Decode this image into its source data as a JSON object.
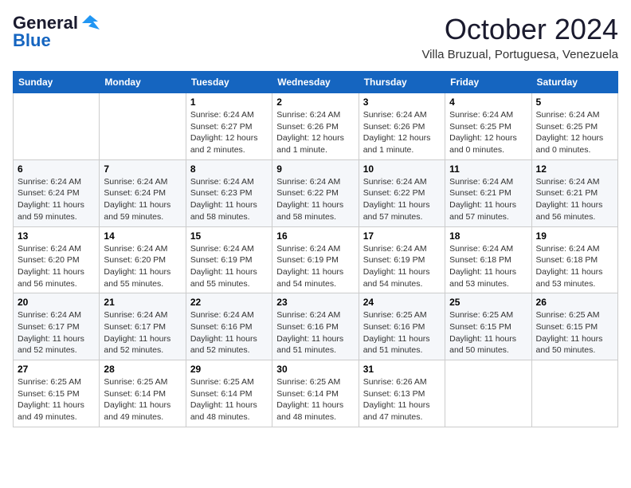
{
  "header": {
    "logo_general": "General",
    "logo_blue": "Blue",
    "month_title": "October 2024",
    "location": "Villa Bruzual, Portuguesa, Venezuela"
  },
  "calendar": {
    "days_of_week": [
      "Sunday",
      "Monday",
      "Tuesday",
      "Wednesday",
      "Thursday",
      "Friday",
      "Saturday"
    ],
    "weeks": [
      [
        {
          "day": "",
          "info": ""
        },
        {
          "day": "",
          "info": ""
        },
        {
          "day": "1",
          "info": "Sunrise: 6:24 AM\nSunset: 6:27 PM\nDaylight: 12 hours and 2 minutes."
        },
        {
          "day": "2",
          "info": "Sunrise: 6:24 AM\nSunset: 6:26 PM\nDaylight: 12 hours and 1 minute."
        },
        {
          "day": "3",
          "info": "Sunrise: 6:24 AM\nSunset: 6:26 PM\nDaylight: 12 hours and 1 minute."
        },
        {
          "day": "4",
          "info": "Sunrise: 6:24 AM\nSunset: 6:25 PM\nDaylight: 12 hours and 0 minutes."
        },
        {
          "day": "5",
          "info": "Sunrise: 6:24 AM\nSunset: 6:25 PM\nDaylight: 12 hours and 0 minutes."
        }
      ],
      [
        {
          "day": "6",
          "info": "Sunrise: 6:24 AM\nSunset: 6:24 PM\nDaylight: 11 hours and 59 minutes."
        },
        {
          "day": "7",
          "info": "Sunrise: 6:24 AM\nSunset: 6:24 PM\nDaylight: 11 hours and 59 minutes."
        },
        {
          "day": "8",
          "info": "Sunrise: 6:24 AM\nSunset: 6:23 PM\nDaylight: 11 hours and 58 minutes."
        },
        {
          "day": "9",
          "info": "Sunrise: 6:24 AM\nSunset: 6:22 PM\nDaylight: 11 hours and 58 minutes."
        },
        {
          "day": "10",
          "info": "Sunrise: 6:24 AM\nSunset: 6:22 PM\nDaylight: 11 hours and 57 minutes."
        },
        {
          "day": "11",
          "info": "Sunrise: 6:24 AM\nSunset: 6:21 PM\nDaylight: 11 hours and 57 minutes."
        },
        {
          "day": "12",
          "info": "Sunrise: 6:24 AM\nSunset: 6:21 PM\nDaylight: 11 hours and 56 minutes."
        }
      ],
      [
        {
          "day": "13",
          "info": "Sunrise: 6:24 AM\nSunset: 6:20 PM\nDaylight: 11 hours and 56 minutes."
        },
        {
          "day": "14",
          "info": "Sunrise: 6:24 AM\nSunset: 6:20 PM\nDaylight: 11 hours and 55 minutes."
        },
        {
          "day": "15",
          "info": "Sunrise: 6:24 AM\nSunset: 6:19 PM\nDaylight: 11 hours and 55 minutes."
        },
        {
          "day": "16",
          "info": "Sunrise: 6:24 AM\nSunset: 6:19 PM\nDaylight: 11 hours and 54 minutes."
        },
        {
          "day": "17",
          "info": "Sunrise: 6:24 AM\nSunset: 6:19 PM\nDaylight: 11 hours and 54 minutes."
        },
        {
          "day": "18",
          "info": "Sunrise: 6:24 AM\nSunset: 6:18 PM\nDaylight: 11 hours and 53 minutes."
        },
        {
          "day": "19",
          "info": "Sunrise: 6:24 AM\nSunset: 6:18 PM\nDaylight: 11 hours and 53 minutes."
        }
      ],
      [
        {
          "day": "20",
          "info": "Sunrise: 6:24 AM\nSunset: 6:17 PM\nDaylight: 11 hours and 52 minutes."
        },
        {
          "day": "21",
          "info": "Sunrise: 6:24 AM\nSunset: 6:17 PM\nDaylight: 11 hours and 52 minutes."
        },
        {
          "day": "22",
          "info": "Sunrise: 6:24 AM\nSunset: 6:16 PM\nDaylight: 11 hours and 52 minutes."
        },
        {
          "day": "23",
          "info": "Sunrise: 6:24 AM\nSunset: 6:16 PM\nDaylight: 11 hours and 51 minutes."
        },
        {
          "day": "24",
          "info": "Sunrise: 6:25 AM\nSunset: 6:16 PM\nDaylight: 11 hours and 51 minutes."
        },
        {
          "day": "25",
          "info": "Sunrise: 6:25 AM\nSunset: 6:15 PM\nDaylight: 11 hours and 50 minutes."
        },
        {
          "day": "26",
          "info": "Sunrise: 6:25 AM\nSunset: 6:15 PM\nDaylight: 11 hours and 50 minutes."
        }
      ],
      [
        {
          "day": "27",
          "info": "Sunrise: 6:25 AM\nSunset: 6:15 PM\nDaylight: 11 hours and 49 minutes."
        },
        {
          "day": "28",
          "info": "Sunrise: 6:25 AM\nSunset: 6:14 PM\nDaylight: 11 hours and 49 minutes."
        },
        {
          "day": "29",
          "info": "Sunrise: 6:25 AM\nSunset: 6:14 PM\nDaylight: 11 hours and 48 minutes."
        },
        {
          "day": "30",
          "info": "Sunrise: 6:25 AM\nSunset: 6:14 PM\nDaylight: 11 hours and 48 minutes."
        },
        {
          "day": "31",
          "info": "Sunrise: 6:26 AM\nSunset: 6:13 PM\nDaylight: 11 hours and 47 minutes."
        },
        {
          "day": "",
          "info": ""
        },
        {
          "day": "",
          "info": ""
        }
      ]
    ]
  }
}
